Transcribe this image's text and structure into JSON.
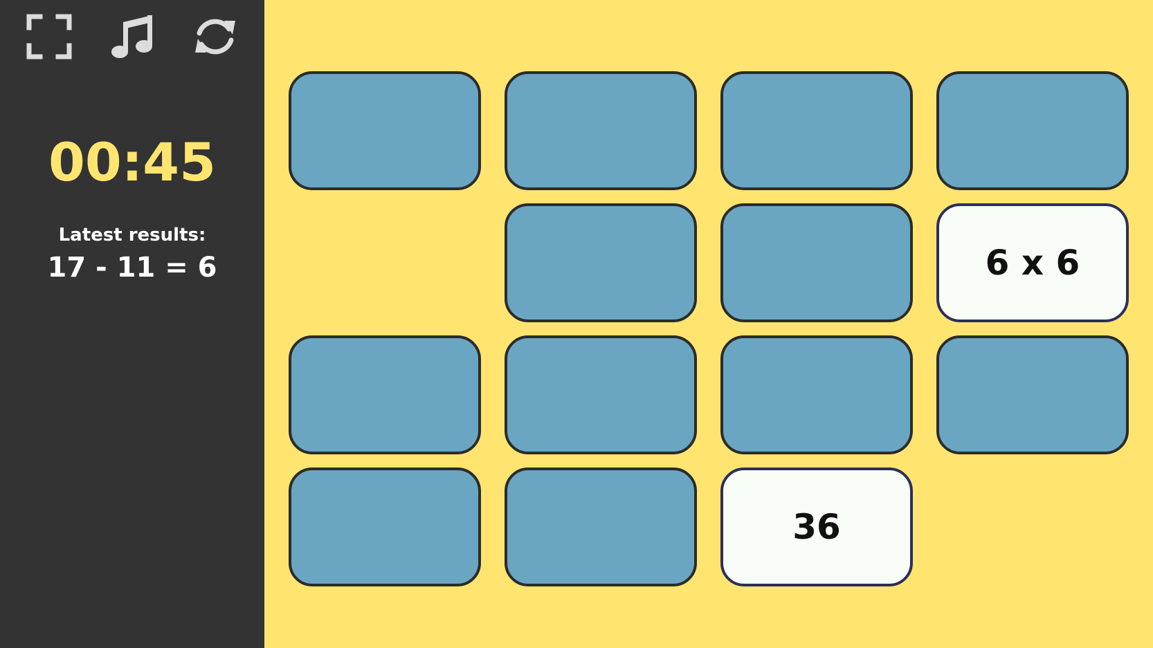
{
  "toolbar": {
    "fullscreen_icon": "fullscreen-icon",
    "music_icon": "music-note-icon",
    "restart_icon": "refresh-icon"
  },
  "timer": {
    "value": "00:45"
  },
  "results": {
    "label": "Latest results:",
    "value": "17 - 11 = 6"
  },
  "colors": {
    "background": "#ffe570",
    "sidebar": "#333333",
    "card_back": "#6aa6c1",
    "card_face": "#f8fdf7",
    "timer": "#ffe570"
  },
  "board": {
    "rows": 4,
    "columns": 4,
    "cards": [
      {
        "state": "hidden",
        "text": ""
      },
      {
        "state": "hidden",
        "text": ""
      },
      {
        "state": "hidden",
        "text": ""
      },
      {
        "state": "hidden",
        "text": ""
      },
      {
        "state": "matched",
        "text": ""
      },
      {
        "state": "hidden",
        "text": ""
      },
      {
        "state": "hidden",
        "text": ""
      },
      {
        "state": "open",
        "text": "6 x 6"
      },
      {
        "state": "hidden",
        "text": ""
      },
      {
        "state": "hidden",
        "text": ""
      },
      {
        "state": "hidden",
        "text": ""
      },
      {
        "state": "hidden",
        "text": ""
      },
      {
        "state": "hidden",
        "text": ""
      },
      {
        "state": "hidden",
        "text": ""
      },
      {
        "state": "open",
        "text": "36"
      },
      {
        "state": "matched",
        "text": ""
      }
    ]
  }
}
